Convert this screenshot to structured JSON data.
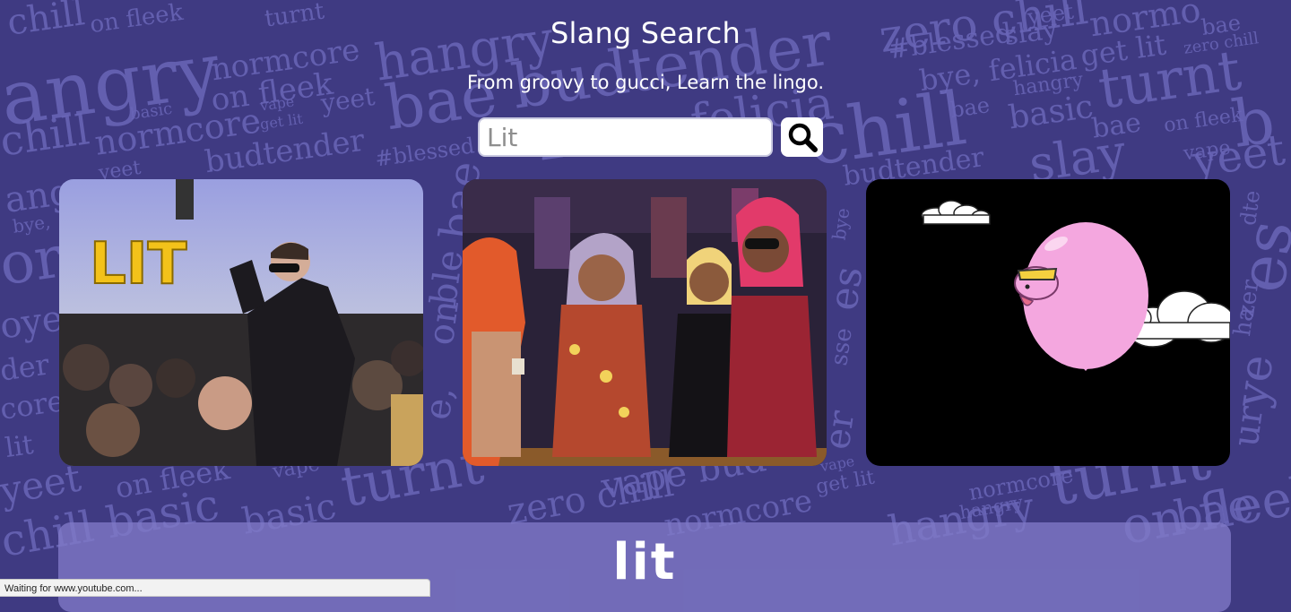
{
  "header": {
    "title": "Slang Search",
    "subtitle": "From groovy to gucci, Learn the lingo."
  },
  "search": {
    "placeholder": "Lit",
    "button_icon": "search-icon"
  },
  "results": {
    "gifs": [
      {
        "name": "gif-lit-concert",
        "caption_text": "LIT"
      },
      {
        "name": "gif-party-wigs"
      },
      {
        "name": "gif-balloon-cartoon"
      }
    ]
  },
  "definition": {
    "word": "lit"
  },
  "status_bar": {
    "text": "Waiting for www.youtube.com..."
  },
  "background": {
    "words": [
      "chill",
      "on fleek",
      "turnt",
      "hangry",
      "normcore",
      "bae",
      "budtender",
      "zero chill",
      "#blessed",
      "yeet",
      "bye, felicia",
      "get lit",
      "basic",
      "vape",
      "slay"
    ]
  },
  "colors": {
    "background": "#3f3a82",
    "background_words": "#6a66b8",
    "definition_card": "#807ac8"
  }
}
